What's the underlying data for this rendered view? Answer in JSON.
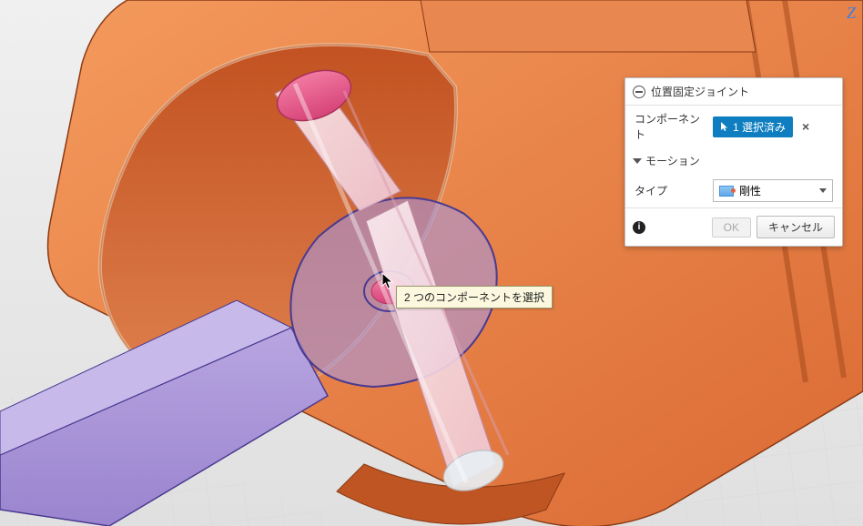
{
  "viewport": {
    "axis_z_label": "Z"
  },
  "tooltip": {
    "text": "2 つのコンポーネントを選択"
  },
  "dialog": {
    "title": "位置固定ジョイント",
    "component": {
      "label": "コンポーネント",
      "chip_text": "1 選択済み"
    },
    "motion_section": "モーション",
    "type": {
      "label": "タイプ",
      "value": "剛性"
    },
    "buttons": {
      "ok": "OK",
      "cancel": "キャンセル"
    }
  }
}
